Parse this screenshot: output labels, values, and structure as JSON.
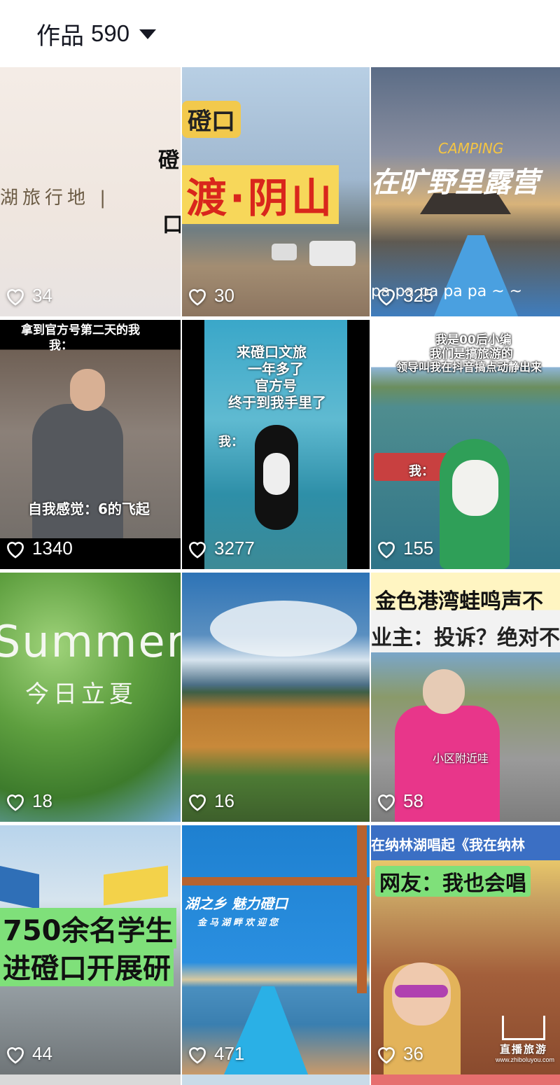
{
  "header": {
    "tab_label": "作品",
    "count": "590"
  },
  "colors": {
    "heart": "#ffffff",
    "text": "#161823"
  },
  "videos": [
    {
      "likes": "34",
      "overlay": [
        "湖旅行地 |",
        "磴",
        "口"
      ]
    },
    {
      "likes": "30",
      "overlay": [
        "磴口",
        "渡·阴山"
      ]
    },
    {
      "likes": "325",
      "overlay": [
        "CAMPING",
        "在旷野里露营",
        "pa pa pa pa pa ~ ~"
      ]
    },
    {
      "likes": "1340",
      "overlay": [
        "拿到官方号第二天的我",
        "我：",
        "自我感觉：6的飞起"
      ]
    },
    {
      "likes": "3277",
      "overlay": [
        "来磴口文旅",
        "一年多了",
        "官方号",
        "终于到我手里了",
        "我："
      ]
    },
    {
      "likes": "155",
      "overlay": [
        "我是00后小编",
        "我们是搞旅游的",
        "领导叫我在抖音搞点动静出来",
        "我："
      ]
    },
    {
      "likes": "18",
      "overlay": [
        "Summer",
        "今日立夏"
      ]
    },
    {
      "likes": "16",
      "overlay": []
    },
    {
      "likes": "58",
      "overlay": [
        "金色港湾蛙鸣声不",
        "业主：投诉？绝对不",
        "小区附近哇"
      ]
    },
    {
      "likes": "44",
      "overlay": [
        "750余名学生",
        "进磴口开展研"
      ]
    },
    {
      "likes": "471",
      "overlay": [
        "湖之乡 魅力磴口",
        "金马湖畔欢迎您"
      ]
    },
    {
      "likes": "36",
      "overlay": [
        "在纳林湖唱起《我在纳林",
        "网友：我也会唱"
      ]
    }
  ],
  "watermark": {
    "title": "直播旅游",
    "url": "www.zhiboluyou.com"
  }
}
